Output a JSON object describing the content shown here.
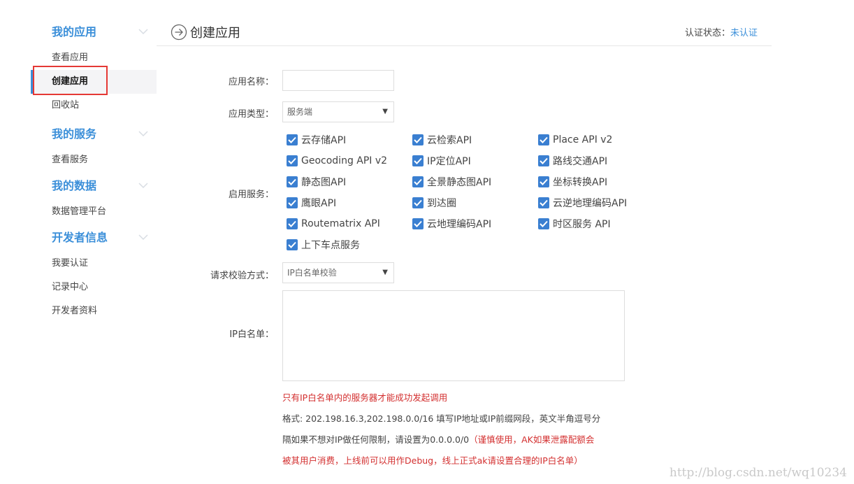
{
  "sidebar": {
    "sections": [
      {
        "title": "我的应用",
        "items": [
          "查看应用",
          "创建应用",
          "回收站"
        ]
      },
      {
        "title": "我的服务",
        "items": [
          "查看服务"
        ]
      },
      {
        "title": "我的数据",
        "items": [
          "数据管理平台"
        ]
      },
      {
        "title": "开发者信息",
        "items": [
          "我要认证",
          "记录中心",
          "开发者资料"
        ]
      }
    ],
    "active_item": "创建应用"
  },
  "header": {
    "title": "创建应用",
    "auth_label": "认证状态：",
    "auth_status": "未认证"
  },
  "form": {
    "app_name_label": "应用名称：",
    "app_name_value": "",
    "app_type_label": "应用类型：",
    "app_type_value": "服务端",
    "services_label": "启用服务：",
    "services": [
      {
        "label": "云存储API",
        "checked": true
      },
      {
        "label": "云检索API",
        "checked": true
      },
      {
        "label": "Place API v2",
        "checked": true
      },
      {
        "label": "Geocoding API v2",
        "checked": true
      },
      {
        "label": "IP定位API",
        "checked": true
      },
      {
        "label": "路线交通API",
        "checked": true
      },
      {
        "label": "静态图API",
        "checked": true
      },
      {
        "label": "全景静态图API",
        "checked": true
      },
      {
        "label": "坐标转换API",
        "checked": true
      },
      {
        "label": "鹰眼API",
        "checked": true
      },
      {
        "label": "到达圈",
        "checked": true
      },
      {
        "label": "云逆地理编码API",
        "checked": true
      },
      {
        "label": "Routematrix API",
        "checked": true
      },
      {
        "label": "云地理编码API",
        "checked": true
      },
      {
        "label": "时区服务 API",
        "checked": true
      },
      {
        "label": "上下车点服务",
        "checked": true
      }
    ],
    "verify_label": "请求校验方式：",
    "verify_value": "IP白名单校验",
    "whitelist_label": "IP白名单：",
    "whitelist_value": "",
    "notes": {
      "line1": "只有IP白名单内的服务器才能成功发起调用",
      "line2": "格式: 202.198.16.3,202.198.0.0/16 填写IP地址或IP前缀网段，英文半角逗号分",
      "line3_prefix": "隔如果不想对IP做任何限制，请设置为0.0.0.0/0",
      "line3_warning": "（谨慎使用，AK如果泄露配额会",
      "line4": "被其用户消费，上线前可以用作Debug，线上正式ak请设置合理的IP白名单）"
    }
  },
  "watermark": "http://blog.csdn.net/wq10234",
  "colors": {
    "accent": "#3b8fd9",
    "checkbox": "#3a7fd1",
    "warning": "#d32f2f",
    "highlight_border": "#e53935"
  }
}
